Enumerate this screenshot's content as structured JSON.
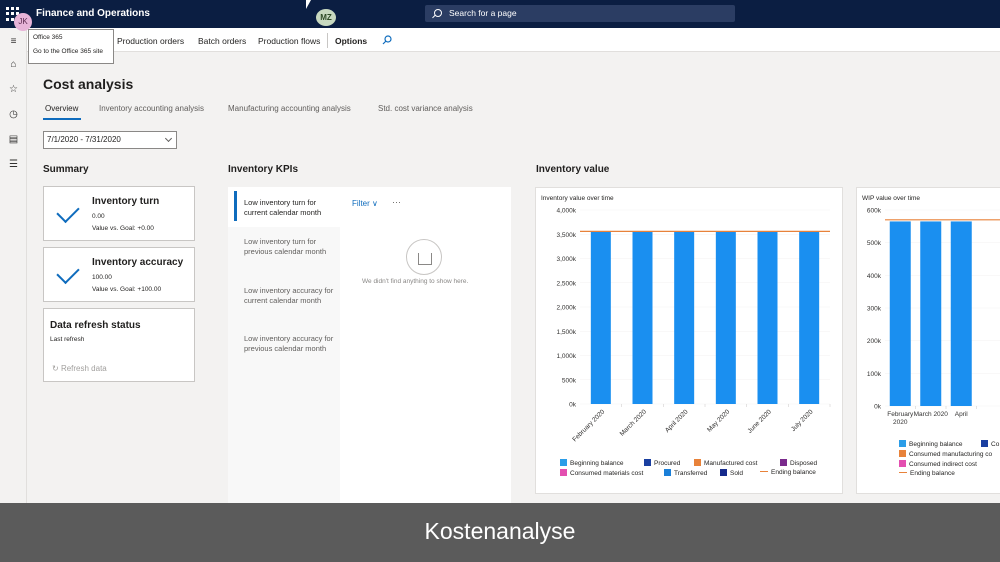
{
  "header": {
    "app_title": "Finance and Operations",
    "search_placeholder": "Search for a page",
    "user_initials": "JK",
    "presence_initials": "MZ"
  },
  "tooltip": {
    "title": "Office 365",
    "link": "Go to the Office 365 site"
  },
  "actionbar": {
    "items": [
      "Production orders",
      "Batch orders",
      "Production flows"
    ],
    "options_label": "Options"
  },
  "page": {
    "title": "Cost analysis",
    "tabs": [
      "Overview",
      "Inventory accounting analysis",
      "Manufacturing accounting analysis",
      "Std. cost variance analysis"
    ],
    "date_range": "7/1/2020 - 7/31/2020"
  },
  "summary": {
    "heading": "Summary",
    "tiles": [
      {
        "title": "Inventory turn",
        "value": "0.00",
        "goal": "Value vs. Goal: +0.00"
      },
      {
        "title": "Inventory accuracy",
        "value": "100.00",
        "goal": "Value vs. Goal: +100.00"
      }
    ],
    "refresh": {
      "title": "Data refresh status",
      "subtitle": "Last refresh",
      "button": "Refresh data"
    }
  },
  "kpis": {
    "heading": "Inventory KPIs",
    "items": [
      "Low inventory turn for current calendar month",
      "Low inventory turn for previous calendar month",
      "Low inventory accuracy for current calendar month",
      "Low inventory accuracy for previous calendar month"
    ],
    "filter_label": "Filter",
    "more_label": "···",
    "empty_text": "We didn't find anything to show here."
  },
  "inventory_value": {
    "heading": "Inventory value"
  },
  "chart_data": [
    {
      "type": "bar",
      "title": "Inventory value over time",
      "categories": [
        "February 2020",
        "March 2020",
        "April 2020",
        "May 2020",
        "June 2020",
        "July 2020"
      ],
      "series": [
        {
          "name": "Transferred",
          "values": [
            3550,
            3550,
            3550,
            3550,
            3550,
            3550
          ]
        },
        {
          "name": "Ending balance",
          "type": "line",
          "values": [
            3560,
            3560,
            3560,
            3560,
            3560,
            3560
          ]
        }
      ],
      "y_ticks": [
        "4,000k",
        "3,500k",
        "3,000k",
        "2,500k",
        "2,000k",
        "1,500k",
        "1,000k",
        "500k",
        "0k"
      ],
      "ylim": [
        0,
        4000
      ],
      "legend": [
        "Beginning balance",
        "Procured",
        "Manufactured cost",
        "Disposed",
        "Consumed materials cost",
        "Transferred",
        "Sold",
        "Ending balance"
      ],
      "legend_colors": [
        "#2b9de8",
        "#1a3fa0",
        "#e8823a",
        "#7a2a8c",
        "#e34fb0",
        "#1a7fd8",
        "#152a8c",
        "#e8823a"
      ],
      "bar_color": "#1a8ff0",
      "line_color": "#e8823a"
    },
    {
      "type": "bar",
      "title": "WIP value over time",
      "categories": [
        "February 2020",
        "March 2020",
        "April"
      ],
      "series": [
        {
          "name": "Consumed manufacturing cost",
          "values": [
            565,
            565,
            565
          ]
        },
        {
          "name": "Ending balance",
          "type": "line",
          "values": [
            570,
            570,
            570
          ]
        }
      ],
      "y_ticks": [
        "600k",
        "500k",
        "400k",
        "300k",
        "200k",
        "100k",
        "0k"
      ],
      "ylim": [
        0,
        600
      ],
      "legend": [
        "Beginning balance",
        "Co",
        "Consumed manufacturing co",
        "Consumed indirect cost",
        "Ending balance"
      ],
      "legend_colors": [
        "#2b9de8",
        "#1a3fa0",
        "#e8823a",
        "#e34fb0",
        "#e8823a"
      ],
      "bar_color": "#1a8ff0",
      "line_color": "#e8823a"
    }
  ],
  "caption": "Kostenanalyse"
}
